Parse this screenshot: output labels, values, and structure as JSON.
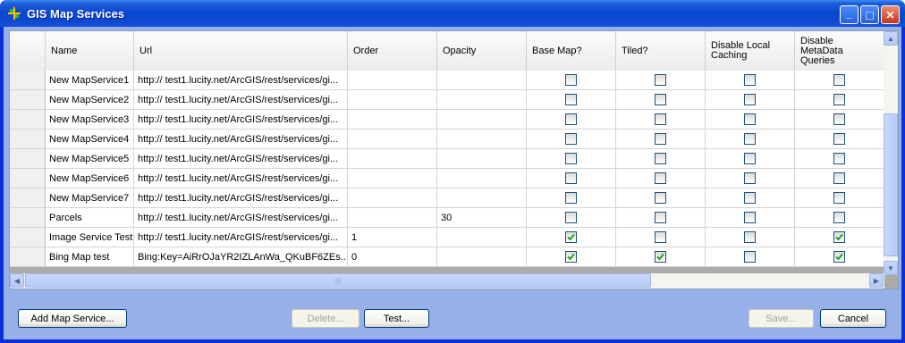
{
  "window": {
    "title": "GIS Map Services",
    "minimize_glyph": "_",
    "maximize_glyph": "□",
    "close_glyph": "✕"
  },
  "grid": {
    "columns": [
      "Name",
      "Url",
      "Order",
      "Opacity",
      "Base Map?",
      "Tiled?",
      "Disable Local Caching",
      "Disable MetaData Queries"
    ],
    "rows": [
      {
        "name": "New MapService1",
        "url": "http:// test1.lucity.net/ArcGIS/rest/services/gi...",
        "order": "",
        "opacity": "",
        "base_map": false,
        "tiled": false,
        "disable_caching": false,
        "disable_metadata": false
      },
      {
        "name": "New MapService2",
        "url": "http:// test1.lucity.net/ArcGIS/rest/services/gi...",
        "order": "",
        "opacity": "",
        "base_map": false,
        "tiled": false,
        "disable_caching": false,
        "disable_metadata": false
      },
      {
        "name": "New MapService3",
        "url": "http:// test1.lucity.net/ArcGIS/rest/services/gi...",
        "order": "",
        "opacity": "",
        "base_map": false,
        "tiled": false,
        "disable_caching": false,
        "disable_metadata": false
      },
      {
        "name": "New MapService4",
        "url": "http:// test1.lucity.net/ArcGIS/rest/services/gi...",
        "order": "",
        "opacity": "",
        "base_map": false,
        "tiled": false,
        "disable_caching": false,
        "disable_metadata": false
      },
      {
        "name": "New MapService5",
        "url": "http:// test1.lucity.net/ArcGIS/rest/services/gi...",
        "order": "",
        "opacity": "",
        "base_map": false,
        "tiled": false,
        "disable_caching": false,
        "disable_metadata": false
      },
      {
        "name": "New MapService6",
        "url": "http:// test1.lucity.net/ArcGIS/rest/services/gi...",
        "order": "",
        "opacity": "",
        "base_map": false,
        "tiled": false,
        "disable_caching": false,
        "disable_metadata": false
      },
      {
        "name": "New MapService7",
        "url": "http:// test1.lucity.net/ArcGIS/rest/services/gi...",
        "order": "",
        "opacity": "",
        "base_map": false,
        "tiled": false,
        "disable_caching": false,
        "disable_metadata": false
      },
      {
        "name": "Parcels",
        "url": "http:// test1.lucity.net/ArcGIS/rest/services/gi...",
        "order": "",
        "opacity": "30",
        "base_map": false,
        "tiled": false,
        "disable_caching": false,
        "disable_metadata": false
      },
      {
        "name": "Image Service Test",
        "url": "http:// test1.lucity.net/ArcGIS/rest/services/gi...",
        "order": "1",
        "opacity": "",
        "base_map": true,
        "tiled": false,
        "disable_caching": false,
        "disable_metadata": true
      },
      {
        "name": "Bing Map test",
        "url": "Bing:Key=AiRrOJaYR2IZLAnWa_QKuBF6ZEs...",
        "order": "0",
        "opacity": "",
        "base_map": true,
        "tiled": true,
        "disable_caching": false,
        "disable_metadata": true
      }
    ]
  },
  "buttons": {
    "add": "Add Map Service...",
    "delete": "Delete...",
    "test": "Test...",
    "save": "Save...",
    "cancel": "Cancel"
  },
  "colors": {
    "title_bar": "#0a47d0",
    "client_background": "#98b0e8",
    "checkbox_check": "#21a121"
  }
}
